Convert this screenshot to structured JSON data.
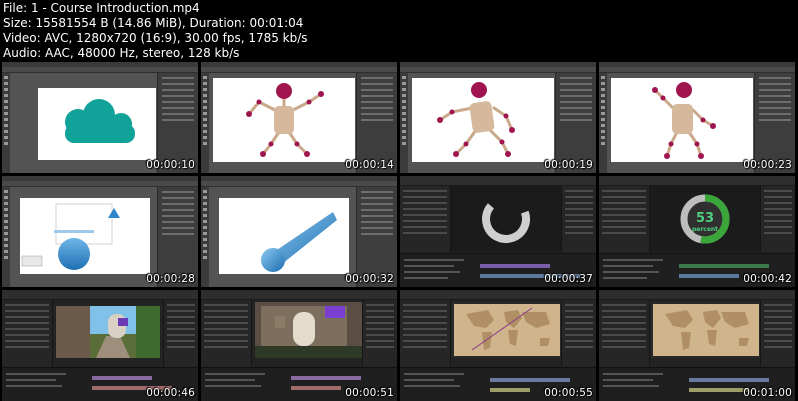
{
  "info": {
    "file": "File: 1 - Course Introduction.mp4",
    "size": "Size: 15581554 B (14.86 MiB), Duration: 00:01:04",
    "video": "Video: AVC, 1280x720 (16:9), 30.00 fps, 1785 kb/s",
    "audio": "Audio: AAC, 48000 Hz, stereo, 128 kb/s"
  },
  "thumbnails": [
    {
      "timestamp": "00:00:10"
    },
    {
      "timestamp": "00:00:14"
    },
    {
      "timestamp": "00:00:19"
    },
    {
      "timestamp": "00:00:23"
    },
    {
      "timestamp": "00:00:28"
    },
    {
      "timestamp": "00:00:32"
    },
    {
      "timestamp": "00:00:37"
    },
    {
      "timestamp": "00:00:42"
    },
    {
      "timestamp": "00:00:46"
    },
    {
      "timestamp": "00:00:51"
    },
    {
      "timestamp": "00:00:55"
    },
    {
      "timestamp": "00:01:00"
    }
  ],
  "overlay_text": {
    "counter_number": "53",
    "counter_label": "percent"
  },
  "colors": {
    "cloud": "#11a39a",
    "joint": "#a0144f",
    "blue_shape": "#2e86c9",
    "ring_green": "#3aa63a",
    "map_paper": "#cfb48c"
  }
}
